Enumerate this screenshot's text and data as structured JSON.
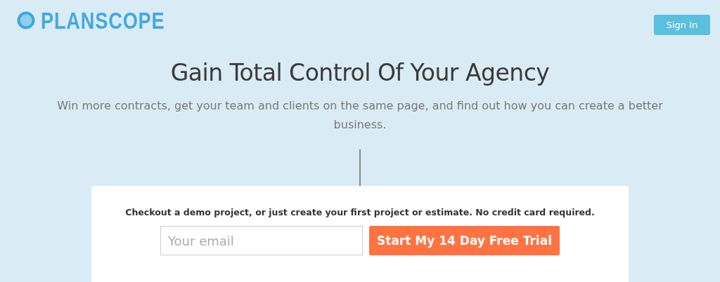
{
  "header": {
    "logo": "PLANSCOPE",
    "sign_in": "Sign In"
  },
  "hero": {
    "title": "Gain Total Control Of Your Agency",
    "subtitle": "Win more contracts, get your team and clients on the same page, and find out how you can create a better business."
  },
  "signup": {
    "note": "Checkout a demo project, or just create your first project or estimate. No credit card required.",
    "email": {
      "placeholder": "Your email"
    },
    "button": "Start My 14 Day Free Trial"
  }
}
